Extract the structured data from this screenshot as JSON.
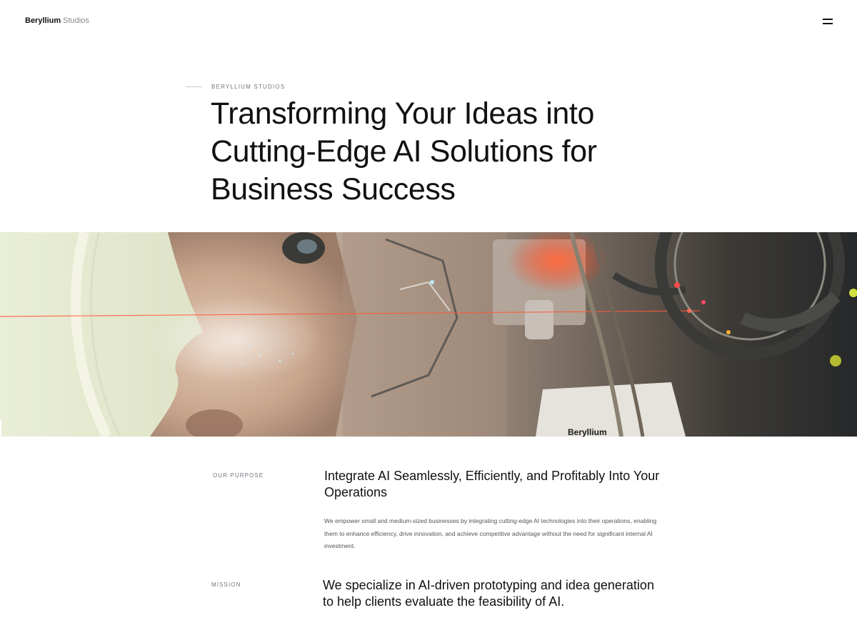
{
  "header": {
    "brand_bold": "Beryllium",
    "brand_light": "Studios",
    "menu_icon": "hamburger-menu-icon"
  },
  "hero": {
    "eyebrow": "BERYLLIUM STUDIOS",
    "title": "Transforming Your Ideas into Cutting-Edge AI Solutions for Business Success"
  },
  "banner": {
    "image_subject": "ai-robot-face-banner",
    "brand_text": "Beryllium",
    "accent_color": "#e8442c"
  },
  "purpose": {
    "label": "OUR PURPOSE",
    "heading": "Integrate AI Seamlessly, Efficiently, and Profitably Into Your Operations",
    "body": "We empower small and medium-sized businesses by integrating cutting-edge AI technologies into their operations, enabling them to enhance efficiency, drive innovation, and achieve competitive advantage without the need for significant internal AI investment."
  },
  "mission": {
    "label": "MISSION",
    "heading": "We specialize in AI-driven prototyping and idea generation to help clients evaluate the feasibility of AI."
  },
  "colors": {
    "text_primary": "#111111",
    "text_muted": "#6f7780",
    "background": "#ffffff"
  }
}
